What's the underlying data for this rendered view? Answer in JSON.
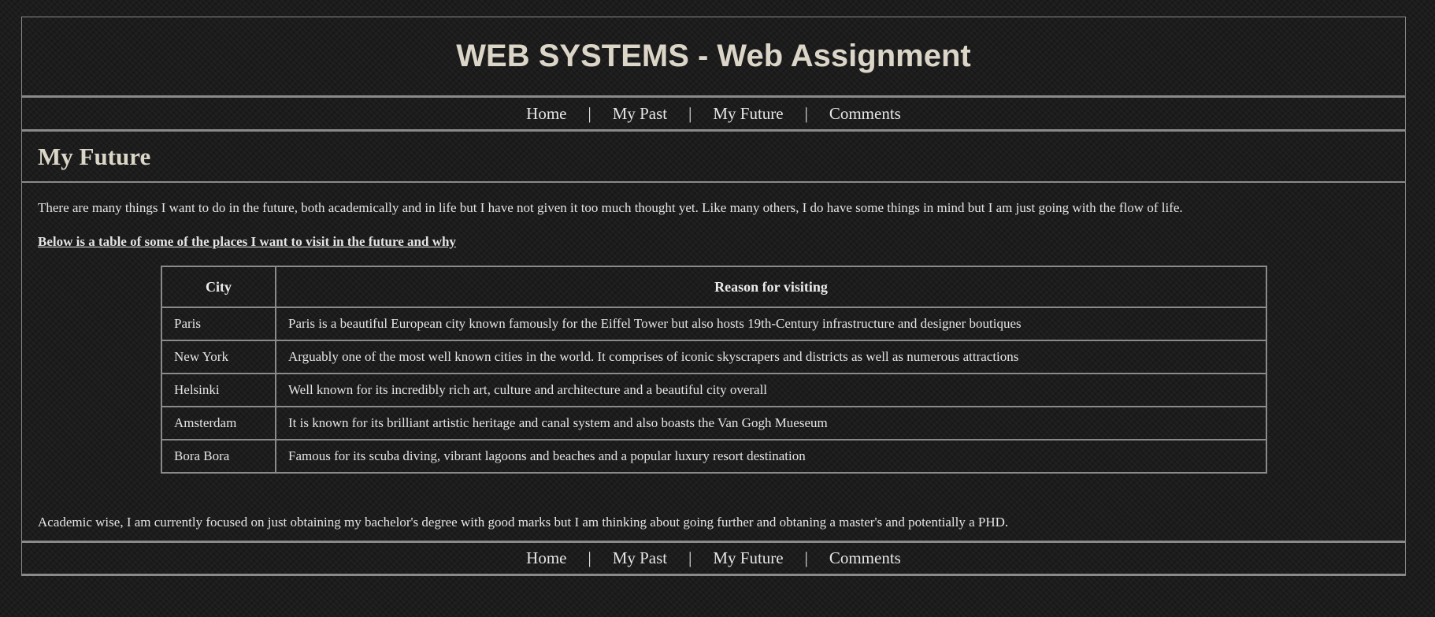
{
  "site_title": "WEB SYSTEMS - Web Assignment",
  "nav": {
    "items": [
      "Home",
      "My Past",
      "My Future",
      "Comments"
    ],
    "separator": "|"
  },
  "page_heading": "My Future",
  "intro_text": "There are many things I want to do in the future, both academically and in life but I have not given it too much thought yet. Like many others, I do have some things in mind but I am just going with the flow of life.",
  "table_heading": "Below is a table of some of the places I want to visit in the future and why",
  "table": {
    "headers": [
      "City",
      "Reason for visiting"
    ],
    "rows": [
      [
        "Paris",
        "Paris is a beautiful European city known famously for the Eiffel Tower but also hosts 19th-Century infrastructure and designer boutiques"
      ],
      [
        "New York",
        "Arguably one of the most well known cities in the world. It comprises of iconic skyscrapers and districts as well as numerous attractions"
      ],
      [
        "Helsinki",
        "Well known for its incredibly rich art, culture and architecture and a beautiful city overall"
      ],
      [
        "Amsterdam",
        "It is known for its brilliant artistic heritage and canal system and also boasts the Van Gogh Mueseum"
      ],
      [
        "Bora Bora",
        "Famous for its scuba diving, vibrant lagoons and beaches and a popular luxury resort destination"
      ]
    ]
  },
  "closing_text": "Academic wise, I am currently focused on just obtaining my bachelor's degree with good marks but I am thinking about going further and obtaning a master's and potentially a PHD."
}
